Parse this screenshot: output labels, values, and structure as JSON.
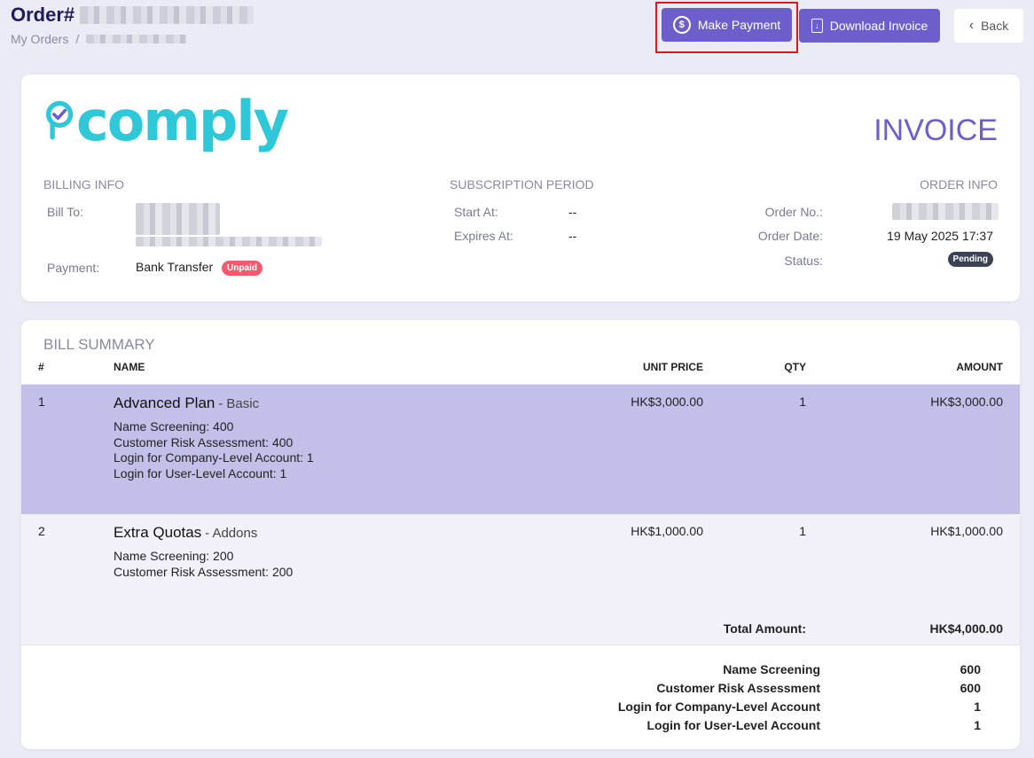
{
  "header": {
    "order_prefix": "Order#",
    "breadcrumb_root": "My Orders",
    "breadcrumb_sep": "/",
    "make_payment_label": "Make Payment",
    "download_invoice_label": "Download Invoice",
    "back_label": "Back"
  },
  "invoice": {
    "logo_text": "comply",
    "title": "INVOICE",
    "billing_info_label": "BILLING INFO",
    "subscription_period_label": "SUBSCRIPTION PERIOD",
    "order_info_label": "ORDER INFO",
    "bill_to_label": "Bill To:",
    "payment_label": "Payment:",
    "payment_value": "Bank Transfer",
    "payment_badge": "Unpaid",
    "start_at_label": "Start At:",
    "start_at_value": "--",
    "expires_at_label": "Expires At:",
    "expires_at_value": "--",
    "order_no_label": "Order No.:",
    "order_date_label": "Order Date:",
    "order_date_value": "19 May 2025 17:37",
    "status_label": "Status:",
    "status_value": "Pending"
  },
  "bill_summary": {
    "title": "BILL SUMMARY",
    "columns": [
      "#",
      "NAME",
      "UNIT PRICE",
      "QTY",
      "AMOUNT"
    ],
    "items": [
      {
        "index": "1",
        "name": "Advanced Plan",
        "category": "- Basic",
        "features": [
          "Name Screening: 400",
          "Customer Risk Assessment: 400",
          "Login for Company-Level Account: 1",
          "Login for User-Level Account: 1"
        ],
        "unit_price": "HK$3,000.00",
        "qty": "1",
        "amount": "HK$3,000.00"
      },
      {
        "index": "2",
        "name": "Extra Quotas",
        "category": "- Addons",
        "features": [
          "Name Screening: 200",
          "Customer Risk Assessment: 200"
        ],
        "unit_price": "HK$1,000.00",
        "qty": "1",
        "amount": "HK$1,000.00"
      }
    ],
    "total_label": "Total Amount:",
    "total_value": "HK$4,000.00",
    "quota_summary": [
      {
        "label": "Name Screening",
        "value": "600"
      },
      {
        "label": "Customer Risk Assessment",
        "value": "600"
      },
      {
        "label": "Login for Company-Level Account",
        "value": "1"
      },
      {
        "label": "Login for User-Level Account",
        "value": "1"
      }
    ]
  },
  "colors": {
    "accent": "#6c5fcb",
    "logo": "#2ec8d8",
    "highlight_border": "#e01818",
    "unpaid": "#f25a6e",
    "pending": "#3b4256",
    "selected_row": "#c2bfe8"
  }
}
